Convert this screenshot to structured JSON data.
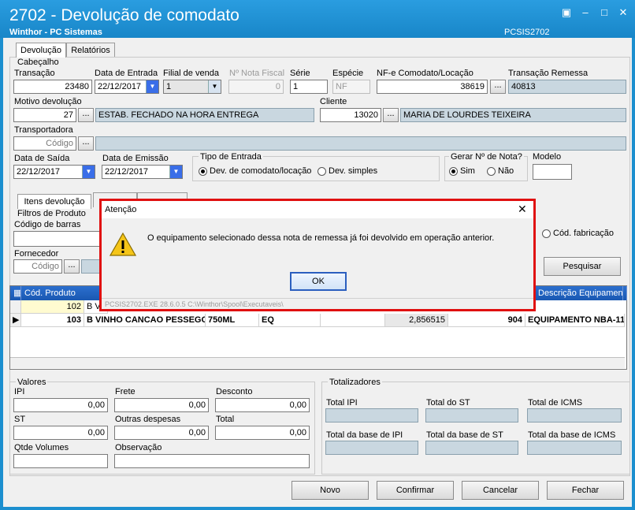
{
  "window": {
    "title": "2702 - Devolução de comodato",
    "subtitle": "Winthor - PC Sistemas",
    "code": "PCSIS2702"
  },
  "tabs": [
    "Devolução",
    "Relatórios"
  ],
  "cabecalho": {
    "legend": "Cabeçalho",
    "transacao_label": "Transação",
    "transacao": "23480",
    "data_entrada_label": "Data de Entrada",
    "data_entrada": "22/12/2017",
    "filial_label": "Filial de venda",
    "filial": "1",
    "nota_fiscal_label": "Nº Nota Fiscal",
    "nota_fiscal": "0",
    "serie_label": "Série",
    "serie": "1",
    "especie_label": "Espécie",
    "especie": "NF",
    "nfe_label": "NF-e Comodato/Locação",
    "nfe": "38619",
    "transacao_remessa_label": "Transação Remessa",
    "transacao_remessa": "40813",
    "motivo_label": "Motivo devolução",
    "motivo_code": "27",
    "motivo_desc": "ESTAB. FECHADO NA HORA ENTREGA",
    "cliente_label": "Cliente",
    "cliente_code": "13020",
    "cliente_nome": "MARIA  DE LOURDES TEIXEIRA",
    "transportadora_label": "Transportadora",
    "transportadora_placeholder": "Código",
    "data_saida_label": "Data de Saída",
    "data_saida": "22/12/2017",
    "data_emissao_label": "Data de Emissão",
    "data_emissao": "22/12/2017",
    "tipo_entrada_label": "Tipo de Entrada",
    "tipo_opt1": "Dev. de comodato/locação",
    "tipo_opt2": "Dev. simples",
    "gerar_label": "Gerar Nº de Nota?",
    "gerar_sim": "Sim",
    "gerar_nao": "Não",
    "modelo_label": "Modelo"
  },
  "itens": {
    "tab_label": "Itens devolução",
    "filtros_label": "Filtros de Produto",
    "codigo_barras_label": "Código de barras",
    "cod_fabricacao_label": "Cód. fabricação",
    "fornecedor_label": "Fornecedor",
    "fornecedor_placeholder": "Código",
    "pesquisar_label": "Pesquisar",
    "columns": [
      "Cód. Produto",
      "Descrição Equipamento"
    ],
    "rows": [
      {
        "cod": "102",
        "desc": "B VINHO CANCAO..."
      },
      {
        "cod": "103",
        "desc": "B VINHO CANCAO PESSEGO",
        "emb": "750ML",
        "un": "EQ",
        "val": "2,856515",
        "num": "904",
        "equip": "EQUIPAMENTO NBA-11"
      }
    ]
  },
  "valores": {
    "legend": "Valores",
    "ipi_label": "IPI",
    "ipi": "0,00",
    "frete_label": "Frete",
    "frete": "0,00",
    "desconto_label": "Desconto",
    "desconto": "0,00",
    "st_label": "ST",
    "st": "0,00",
    "outras_label": "Outras despesas",
    "outras": "0,00",
    "total_label": "Total",
    "total": "0,00",
    "qtde_label": "Qtde Volumes",
    "obs_label": "Observação"
  },
  "totalizadores": {
    "legend": "Totalizadores",
    "labels": [
      "Total IPI",
      "Total do ST",
      "Total de ICMS",
      "Total da base de IPI",
      "Total  da base de ST",
      "Total da base de ICMS"
    ]
  },
  "buttons": {
    "novo": "Novo",
    "confirmar": "Confirmar",
    "cancelar": "Cancelar",
    "fechar": "Fechar"
  },
  "dialog": {
    "title": "Atenção",
    "message": "O equipamento selecionado dessa nota de remessa já foi devolvido em operação anterior.",
    "ok": "OK",
    "footer": "PCSIS2702.EXE 28.6.0.5 C:\\Winthor\\Spool\\Executaveis\\"
  },
  "colors": {
    "titlebar": "#1c8fcf",
    "grid_header": "#1a58b2",
    "dialog_border": "#e01010"
  }
}
